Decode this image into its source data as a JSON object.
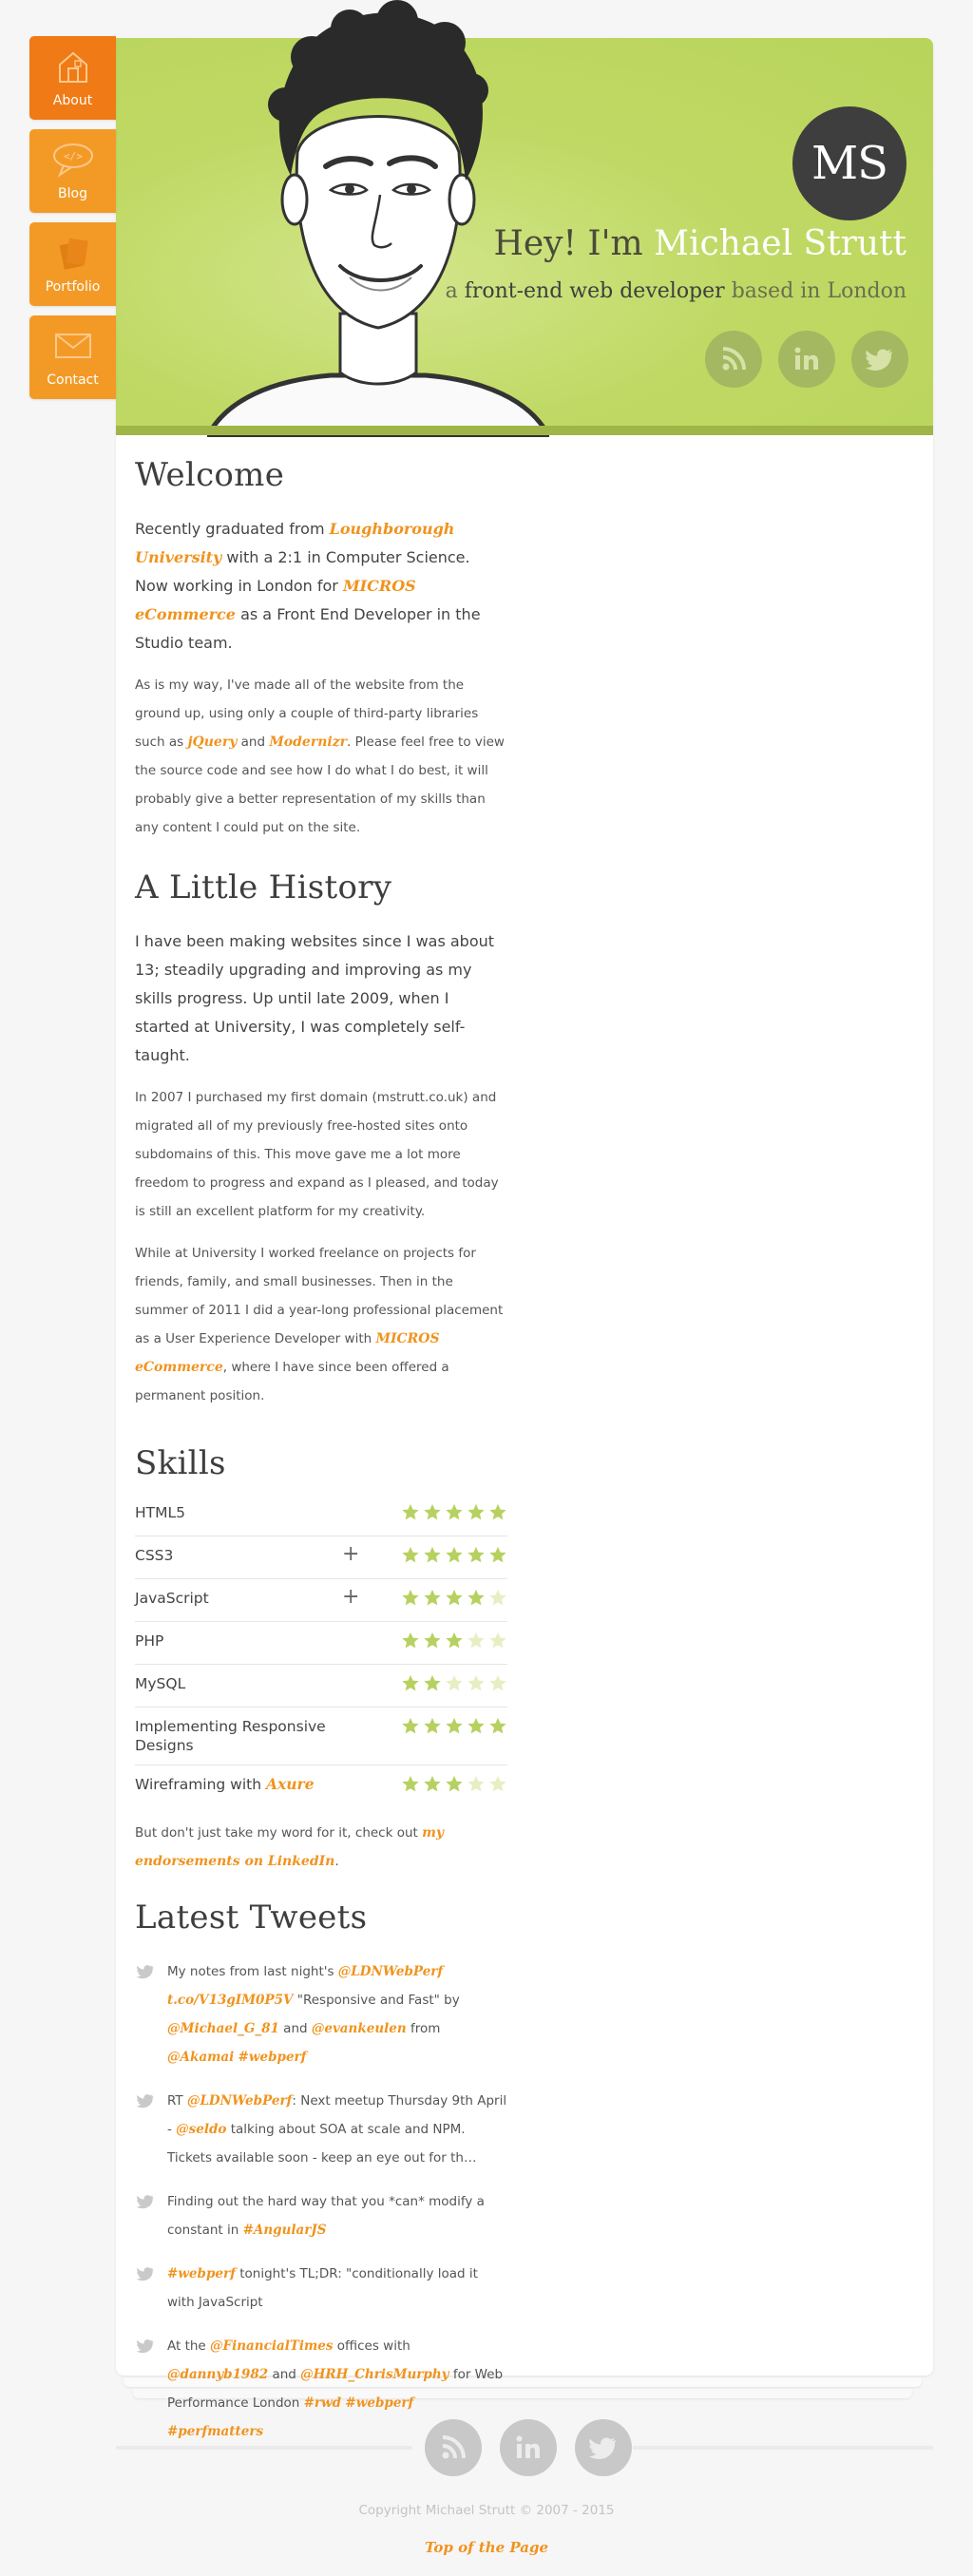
{
  "nav": {
    "items": [
      {
        "label": "About",
        "icon": "house-icon"
      },
      {
        "label": "Blog",
        "icon": "speech-bubble-icon"
      },
      {
        "label": "Portfolio",
        "icon": "documents-icon"
      },
      {
        "label": "Contact",
        "icon": "envelope-icon"
      }
    ]
  },
  "header": {
    "logo": "MS",
    "greeting": "Hey! I'm",
    "name": "Michael Strutt",
    "tagline_prefix": "a",
    "tagline_role": "front-end web developer",
    "tagline_suffix": "based in London",
    "social": [
      "rss-icon",
      "linkedin-icon",
      "twitter-icon"
    ]
  },
  "welcome": {
    "title": "Welcome",
    "p1_a": "Recently graduated from ",
    "p1_link1": "Loughborough University",
    "p1_b": " with a 2:1 in Computer Science. Now working in London for ",
    "p1_link2": "MICROS eCommerce",
    "p1_c": " as a Front End Developer in the Studio team.",
    "p2_a": "As is my way, I've made all of the website from the ground up, using only a couple of third-party libraries such as ",
    "p2_link1": "jQuery",
    "p2_b": " and ",
    "p2_link2": "Modernizr",
    "p2_c": ". Please feel free to view the source code and see how I do what I do best, it will probably give a better representation of my skills than any content I could put on the site."
  },
  "history": {
    "title": "A Little History",
    "p1": "I have been making websites since I was about 13; steadily upgrading and improving as my skills progress. Up until late 2009, when I started at University, I was completely self-taught.",
    "p2": "In 2007 I purchased my first domain (mstrutt.co.uk) and migrated all of my previously free-hosted sites onto subdomains of this. This move gave me a lot more freedom to progress and expand as I pleased, and today is still an excellent platform for my creativity.",
    "p3_a": "While at University I worked freelance on projects for friends, family, and small businesses. Then in the summer of 2011 I did a year-long professional placement as a User Experience Developer with ",
    "p3_link": "MICROS eCommerce",
    "p3_b": ", where I have since been offered a permanent position."
  },
  "skills": {
    "title": "Skills",
    "items": [
      {
        "name": "HTML5",
        "rating": 5,
        "expandable": false
      },
      {
        "name": "CSS3",
        "rating": 5,
        "expandable": true
      },
      {
        "name": "JavaScript",
        "rating": 4,
        "expandable": true
      },
      {
        "name": "PHP",
        "rating": 3,
        "expandable": false
      },
      {
        "name": "MySQL",
        "rating": 2,
        "expandable": false
      },
      {
        "name": "Implementing Responsive Designs",
        "rating": 5,
        "expandable": false
      },
      {
        "name": "Wireframing with",
        "link": "Axure",
        "rating": 3,
        "expandable": false
      }
    ],
    "plus_symbol": "+",
    "note_a": "But don't just take my word for it, check out ",
    "note_link": "my endorsements on LinkedIn",
    "note_b": "."
  },
  "tweets": {
    "title": "Latest Tweets",
    "t1": [
      "My notes from last night's ",
      "@LDNWebPerf",
      " ",
      "t.co/V13gIM0P5V",
      " \"Responsive and Fast\" by ",
      "@Michael_G_81",
      " and ",
      "@evankeulen",
      " from ",
      "@Akamai",
      " ",
      "#webperf"
    ],
    "t2": [
      "RT ",
      "@LDNWebPerf",
      ": Next meetup Thursday 9th April - ",
      "@seldo",
      " talking about SOA at scale and NPM. Tickets available soon - keep an eye out for th…"
    ],
    "t3": [
      "Finding out the hard way that you *can* modify a constant in ",
      "#AngularJS"
    ],
    "t4": [
      "#webperf",
      " tonight's TL;DR: \"conditionally load it with JavaScript"
    ],
    "t5": [
      "At the ",
      "@FinancialTimes",
      " offices with ",
      "@dannyb1982",
      " and ",
      "@HRH_ChrisMurphy",
      " for Web Performance London ",
      "#rwd",
      " ",
      "#webperf",
      " ",
      "#perfmatters"
    ]
  },
  "footer": {
    "social": [
      "rss-icon",
      "linkedin-icon",
      "twitter-icon"
    ],
    "copyright": "Copyright Michael Strutt © 2007 - 2015",
    "top_link": "Top of the Page"
  },
  "colors": {
    "accent": "#f0931e",
    "nav_active": "#f07a15",
    "header_green": "#c0d965",
    "star_on": "#b7d160",
    "star_off": "#e6efc4"
  }
}
